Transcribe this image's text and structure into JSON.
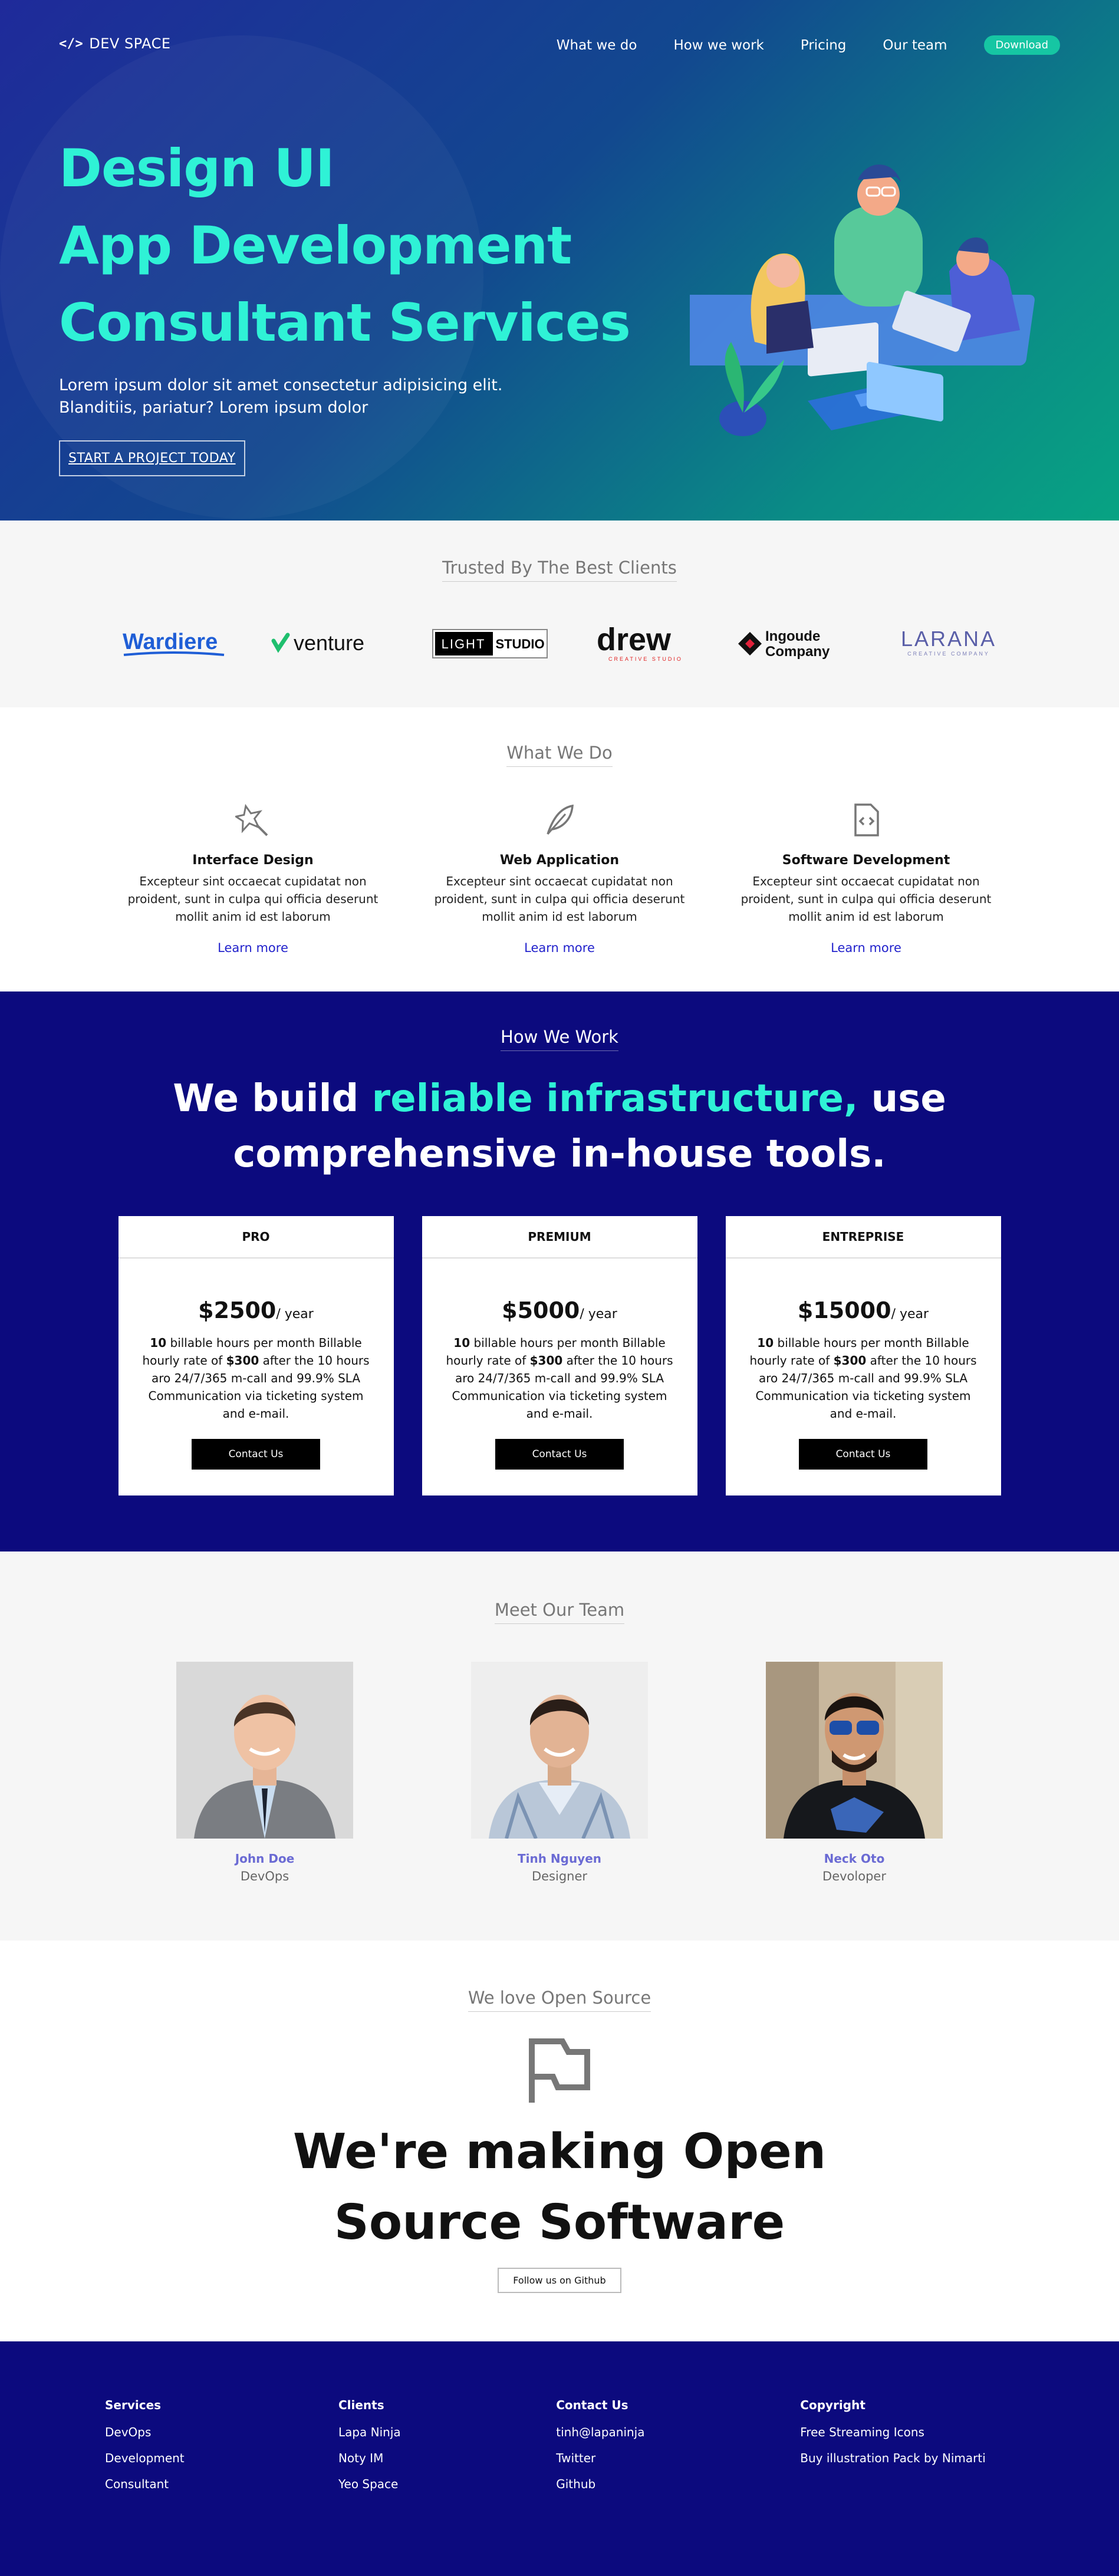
{
  "nav": {
    "brand": "DEV SPACE",
    "links": [
      "What we do",
      "How we work",
      "Pricing",
      "Our team"
    ],
    "download_label": "Download"
  },
  "hero": {
    "lines": [
      "Design UI",
      "App Development",
      "Consultant Services"
    ],
    "subtitle_1": "Lorem ipsum dolor sit amet consectetur adipisicing elit.",
    "subtitle_2": "Blanditiis, pariatur? Lorem ipsum dolor",
    "cta": "START A PROJECT TODAY"
  },
  "clients": {
    "title": "Trusted By The Best Clients",
    "logos": [
      "Wardiere",
      "venture",
      "LIGHT",
      "STUDIO",
      "drew",
      "Ingoude Company",
      "LARANA",
      "CREATIVE STUDIO",
      "CREATIVE COMPANY"
    ]
  },
  "whatwedo": {
    "title": "What We Do",
    "services": [
      {
        "title": "Interface Design",
        "text": "Excepteur sint occaecat cupidatat non proident, sunt in culpa qui officia deserunt mollit anim id est laborum",
        "link": "Learn more",
        "icon": "magic-wand-icon"
      },
      {
        "title": "Web Application",
        "text": "Excepteur sint occaecat cupidatat non proident, sunt in culpa qui officia deserunt mollit anim id est laborum",
        "link": "Learn more",
        "icon": "feather-icon"
      },
      {
        "title": "Software Development",
        "text": "Excepteur sint occaecat cupidatat non proident, sunt in culpa qui officia deserunt mollit anim id est laborum",
        "link": "Learn more",
        "icon": "code-file-icon"
      }
    ]
  },
  "howwework": {
    "title": "How We Work",
    "claim_pre": "We build ",
    "claim_hl": "reliable infrastructure,",
    "claim_post": " use",
    "claim_line2": "comprehensive in-house tools.",
    "plans": [
      {
        "name": "PRO",
        "price": "$2500",
        "period": "/ year",
        "hours": "10",
        "rate": "$300",
        "cta": "Contact Us"
      },
      {
        "name": "PREMIUM",
        "price": "$5000",
        "period": "/ year",
        "hours": "10",
        "rate": "$300",
        "cta": "Contact Us"
      },
      {
        "name": "ENTREPRISE",
        "price": "$15000",
        "period": "/ year",
        "hours": "10",
        "rate": "$300",
        "cta": "Contact Us"
      }
    ],
    "desc_a": " billable hours per month Billable hourly rate of ",
    "desc_b": " after the 10 hours aro 24/7/365 m-call and 99.9% SLA Communication via ticketing system and e-mail."
  },
  "team": {
    "title": "Meet Our Team",
    "members": [
      {
        "name": "John Doe",
        "role": "DevOps"
      },
      {
        "name": "Tinh Nguyen",
        "role": "Designer"
      },
      {
        "name": "Neck Oto",
        "role": "Devoloper"
      }
    ]
  },
  "opensource": {
    "title": "We love Open Source",
    "line1": "We're making Open",
    "line2": "Source Software",
    "button": "Follow us on Github"
  },
  "footer": {
    "columns": [
      {
        "heading": "Services",
        "links": [
          "DevOps",
          "Development",
          "Consultant"
        ]
      },
      {
        "heading": "Clients",
        "links": [
          "Lapa Ninja",
          "Noty IM",
          "Yeo Space"
        ]
      },
      {
        "heading": "Contact Us",
        "links": [
          "tinh@lapaninja",
          "Twitter",
          "Github"
        ]
      },
      {
        "heading": "Copyright",
        "links": [
          "Free Streaming Icons",
          "Buy illustration Pack by Nimarti"
        ]
      }
    ]
  },
  "colors": {
    "accent": "#2ff2d6",
    "navy": "#0c0a7e",
    "teal": "#16c6a3"
  }
}
